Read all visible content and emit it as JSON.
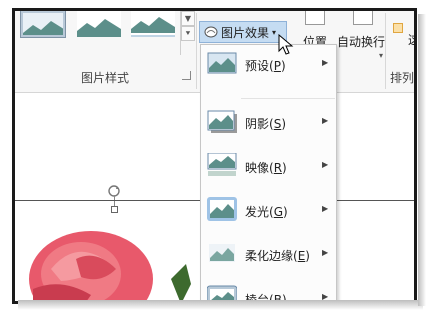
{
  "ribbon": {
    "effects_button_label": "图片效果",
    "gallery_group_label": "图片样式",
    "position_label": "位置",
    "wrap_text_label": "自动换行",
    "arrange_group_label": "排列",
    "arrange_partial_text": "这"
  },
  "menu": {
    "items": [
      {
        "label": "预设",
        "shortcut": "P",
        "icon": "preset-icon"
      },
      {
        "label": "阴影",
        "shortcut": "S",
        "icon": "shadow-icon"
      },
      {
        "label": "映像",
        "shortcut": "R",
        "icon": "reflection-icon"
      },
      {
        "label": "发光",
        "shortcut": "G",
        "icon": "glow-icon"
      },
      {
        "label": "柔化边缘",
        "shortcut": "E",
        "icon": "soft-edges-icon"
      },
      {
        "label": "棱台",
        "shortcut": "B",
        "icon": "bevel-icon"
      }
    ]
  },
  "colors": {
    "accent_highlight": "#c5dcf2",
    "menu_bg": "#fcfcfc",
    "rose": "#e8596b"
  }
}
